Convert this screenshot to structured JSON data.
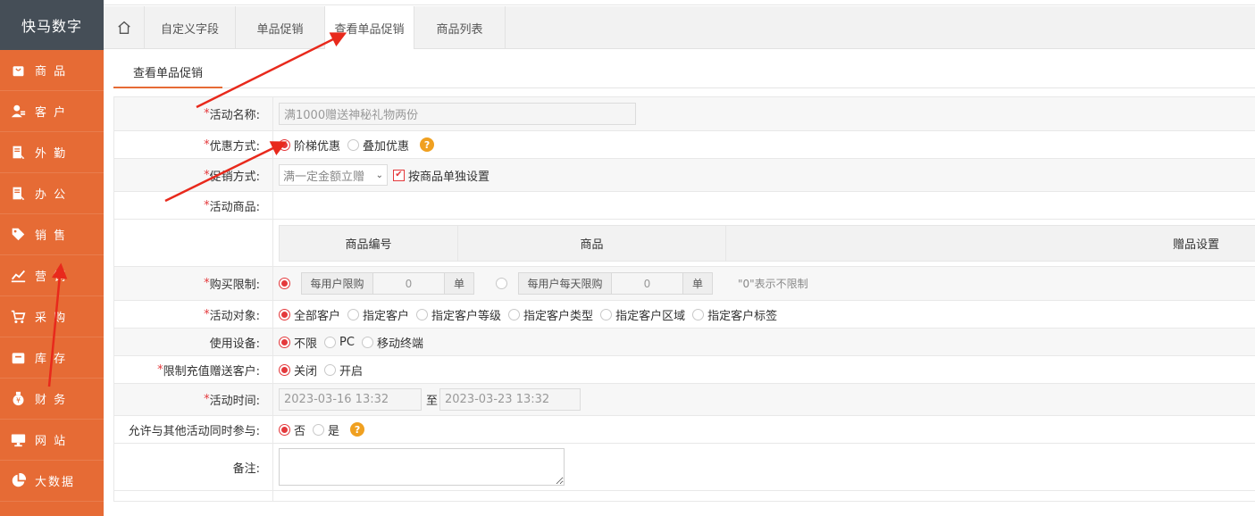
{
  "brand": "快马数字",
  "sidebar": {
    "items": [
      {
        "icon": "bag-icon",
        "label": "商 品"
      },
      {
        "icon": "users-icon",
        "label": "客 户"
      },
      {
        "icon": "clipboard-icon",
        "label": "外 勤"
      },
      {
        "icon": "clipboard-icon",
        "label": "办 公"
      },
      {
        "icon": "tag-icon",
        "label": "销 售"
      },
      {
        "icon": "chart-line-icon",
        "label": "营 销"
      },
      {
        "icon": "cart-icon",
        "label": "采 购"
      },
      {
        "icon": "box-icon",
        "label": "库 存"
      },
      {
        "icon": "money-bag-icon",
        "label": "财 务"
      },
      {
        "icon": "monitor-icon",
        "label": "网 站"
      },
      {
        "icon": "pie-chart-icon",
        "label": "大数据"
      }
    ]
  },
  "tabs": [
    "自定义字段",
    "单品促销",
    "查看单品促销",
    "商品列表"
  ],
  "active_tab": "查看单品促销",
  "subtab": "查看单品促销",
  "form": {
    "activity_name": {
      "label": "活动名称:",
      "value": "满1000赠送神秘礼物两份"
    },
    "discount_mode": {
      "label": "优惠方式:",
      "options": [
        "阶梯优惠",
        "叠加优惠"
      ],
      "selected": "阶梯优惠"
    },
    "promo_mode": {
      "label": "促销方式:",
      "select_value": "满一定金额立赠",
      "checkbox_label": "按商品单独设置",
      "checkbox_checked": true
    },
    "products": {
      "label": "活动商品:",
      "columns": [
        "商品编号",
        "商品",
        "赠品设置"
      ]
    },
    "purchase_limit": {
      "label": "购买限制:",
      "per_user_label": "每用户限购",
      "per_user_value": "0",
      "unit1": "单",
      "per_day_label": "每用户每天限购",
      "per_day_value": "0",
      "unit2": "单",
      "hint": "\"0\"表示不限制"
    },
    "target": {
      "label": "活动对象:",
      "options": [
        "全部客户",
        "指定客户",
        "指定客户等级",
        "指定客户类型",
        "指定客户区域",
        "指定客户标签"
      ],
      "selected": "全部客户"
    },
    "device": {
      "label": "使用设备:",
      "options": [
        "不限",
        "PC",
        "移动终端"
      ],
      "selected": "不限"
    },
    "recharge": {
      "label": "限制充值赠送客户:",
      "options": [
        "关闭",
        "开启"
      ],
      "selected": "关闭"
    },
    "time": {
      "label": "活动时间:",
      "start": "2023-03-16 13:32",
      "to": "至",
      "end": "2023-03-23 13:32"
    },
    "concurrent": {
      "label": "允许与其他活动同时参与:",
      "options": [
        "否",
        "是"
      ],
      "selected": "否"
    },
    "remark": {
      "label": "备注:",
      "value": ""
    }
  },
  "colors": {
    "sidebar": "#e66b35",
    "brand_bg": "#454e57",
    "accent_red": "#e4393c",
    "help": "#f0a020",
    "arrow": "#e8291c"
  }
}
